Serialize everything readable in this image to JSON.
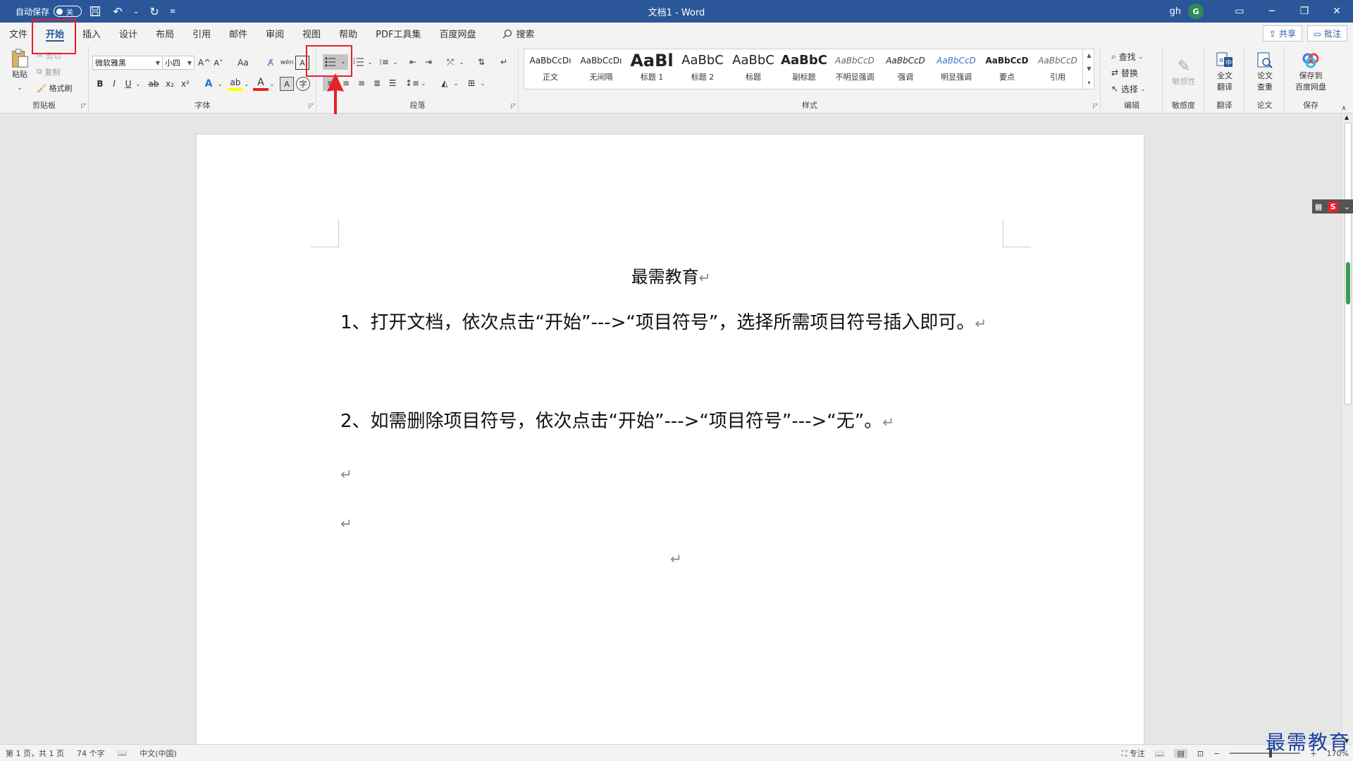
{
  "titlebar": {
    "autosave_label": "自动保存",
    "autosave_state": "关",
    "doc_title": "文档1 - Word",
    "user_name": "gh",
    "avatar_letter": "G"
  },
  "tabs": [
    "文件",
    "开始",
    "插入",
    "设计",
    "布局",
    "引用",
    "邮件",
    "审阅",
    "视图",
    "帮助",
    "PDF工具集",
    "百度网盘"
  ],
  "tab_search": "搜索",
  "share_label": "共享",
  "comment_label": "批注",
  "ribbon": {
    "clipboard": {
      "paste": "粘贴",
      "cut": "剪切",
      "copy": "复制",
      "format_painter": "格式刷",
      "label": "剪贴板"
    },
    "font": {
      "name": "微软雅黑",
      "size": "小四",
      "label": "字体",
      "bold": "B",
      "italic": "I",
      "underline": "U",
      "strike": "ab",
      "sub": "x₂",
      "sup": "x²",
      "grow": "A^",
      "shrink": "A˅",
      "case": "Aa",
      "effect": "A",
      "highlight": "ab",
      "color": "A"
    },
    "paragraph": {
      "label": "段落"
    },
    "styles": {
      "label": "样式",
      "items": [
        {
          "sample": "AaBbCcDı",
          "name": "正文"
        },
        {
          "sample": "AaBbCcDı",
          "name": "无间隔"
        },
        {
          "sample": "AaBl",
          "name": "标题 1"
        },
        {
          "sample": "AaBbC",
          "name": "标题 2"
        },
        {
          "sample": "AaBbC",
          "name": "标题"
        },
        {
          "sample": "AaBbC",
          "name": "副标题"
        },
        {
          "sample": "AaBbCcD",
          "name": "不明显强调"
        },
        {
          "sample": "AaBbCcD",
          "name": "强调"
        },
        {
          "sample": "AaBbCcD",
          "name": "明显强调"
        },
        {
          "sample": "AaBbCcD",
          "name": "要点"
        },
        {
          "sample": "AaBbCcD",
          "name": "引用"
        }
      ]
    },
    "editing": {
      "find": "查找",
      "replace": "替换",
      "select": "选择",
      "label": "编辑"
    },
    "sensitivity": {
      "btn": "敏感性",
      "label": "敏感度"
    },
    "translate": {
      "btn1": "全文",
      "btn2": "翻译",
      "label": "翻译"
    },
    "paper": {
      "btn1": "论文",
      "btn2": "查重",
      "label": "论文"
    },
    "save": {
      "btn1": "保存到",
      "btn2": "百度网盘",
      "label": "保存"
    }
  },
  "document": {
    "heading": "最需教育",
    "para1": "1、打开文档，依次点击“开始”--->“项目符号”，选择所需项目符号插入即可。",
    "para2": "2、如需删除项目符号，依次点击“开始”--->“项目符号”--->“无”。",
    "para_mark": "↵"
  },
  "statusbar": {
    "page": "第 1 页，共 1 页",
    "words": "74 个字",
    "language": "中文(中国)",
    "focus": "专注",
    "zoom": "170%"
  },
  "watermark": "最需教育"
}
